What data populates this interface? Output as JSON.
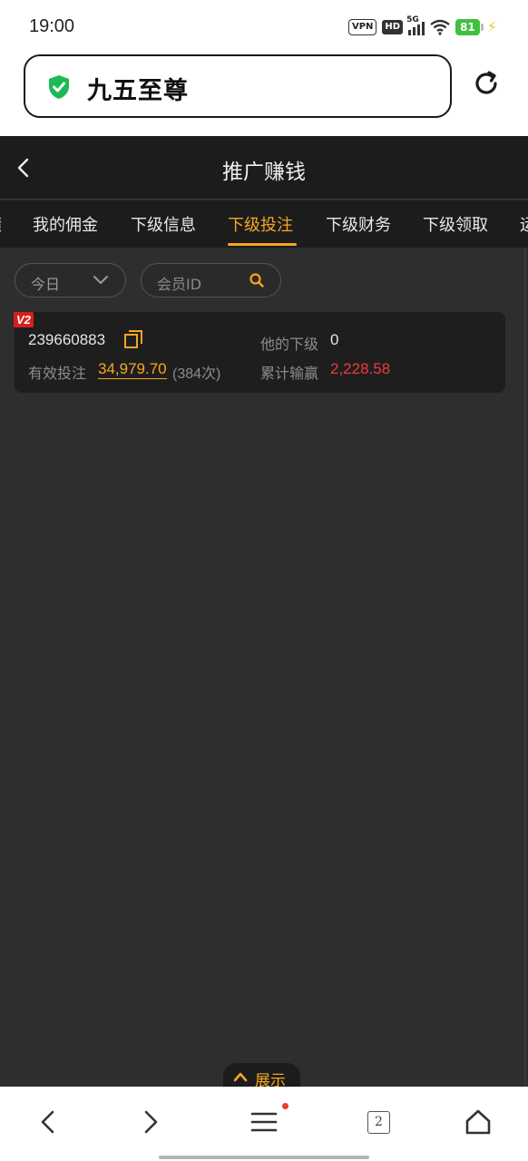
{
  "status_bar": {
    "time": "19:00",
    "vpn": "VPN",
    "hd": "HD",
    "network": "5G",
    "battery": "81"
  },
  "browser": {
    "address_text": "九五至尊",
    "tab_count": "2"
  },
  "header": {
    "title": "推广赚钱"
  },
  "tabs": [
    {
      "label": "绩"
    },
    {
      "label": "我的佣金"
    },
    {
      "label": "下级信息"
    },
    {
      "label": "下级投注",
      "active": true
    },
    {
      "label": "下级财务"
    },
    {
      "label": "下级领取"
    },
    {
      "label": "运"
    }
  ],
  "filters": {
    "date_value": "今日",
    "member_placeholder": "会员ID"
  },
  "member": {
    "level": "V2",
    "id": "239660883",
    "valid_bet_label": "有效投注",
    "valid_bet_value": "34,979.70",
    "bet_count": "(384次)",
    "sub_label": "他的下级",
    "sub_value": "0",
    "win_label": "累计输赢",
    "win_value": "2,228.58"
  },
  "expand": {
    "label": "展示"
  },
  "colors": {
    "accent": "#f5a623",
    "loss_red": "#f03a3a",
    "badge_red": "#d81e1e",
    "header_bg": "#1c1c1c",
    "page_bg": "#2e2e2e",
    "shield_green": "#1db954"
  }
}
